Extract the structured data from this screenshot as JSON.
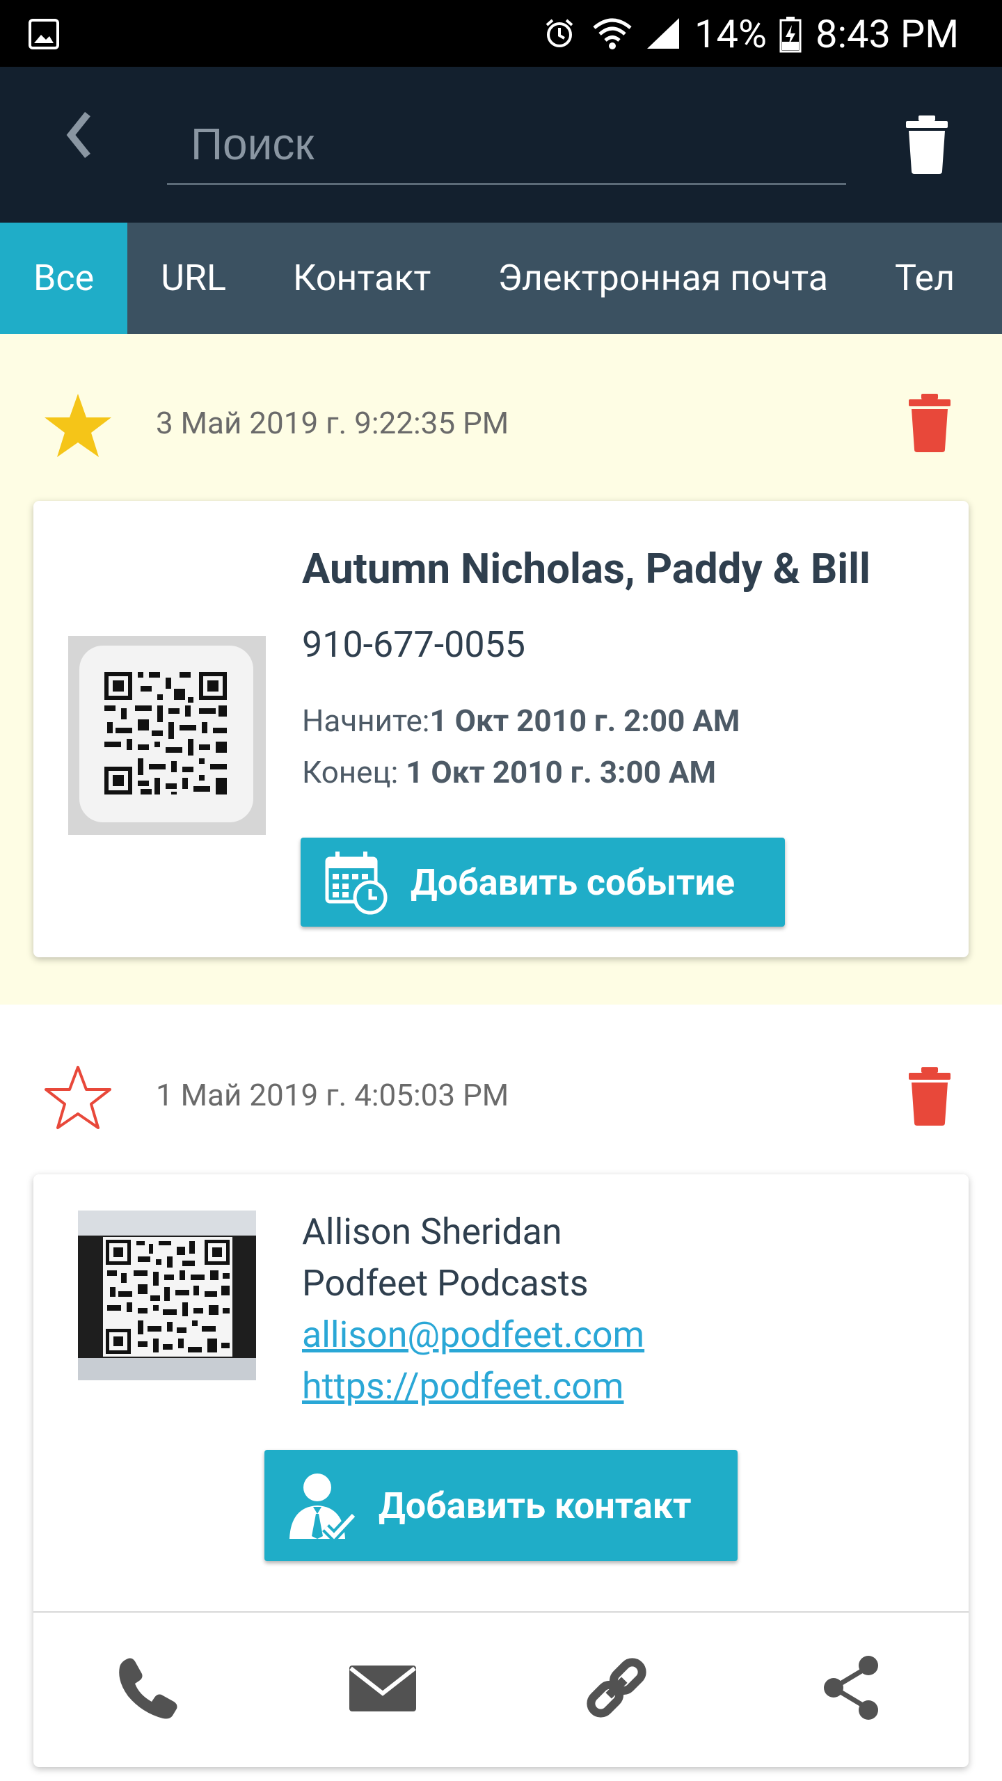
{
  "status_bar": {
    "battery": "14%",
    "time": "8:43 PM"
  },
  "toolbar": {
    "search_placeholder": "Поиск"
  },
  "tabs": [
    {
      "label": "Все",
      "active": true
    },
    {
      "label": "URL",
      "active": false
    },
    {
      "label": "Контакт",
      "active": false
    },
    {
      "label": "Электронная почта",
      "active": false
    },
    {
      "label": "Тел",
      "active": false
    }
  ],
  "items": [
    {
      "favorite": true,
      "date": "3 Май 2019 г. 9:22:35 PM",
      "title": "Autumn Nicholas, Paddy & Bill",
      "phone": "910-677-0055",
      "start_label": "Начните:",
      "start_value": "1 Окт 2010 г. 2:00 AM",
      "end_label": "Конец: ",
      "end_value": "1 Окт 2010 г. 3:00 AM",
      "button_label": "Добавить событие"
    },
    {
      "favorite": false,
      "date": "1 Май 2019 г. 4:05:03 PM",
      "name": "Allison Sheridan",
      "org": "Podfeet Podcasts",
      "email": "allison@podfeet.com",
      "url": "https://podfeet.com",
      "button_label": "Добавить контакт"
    }
  ],
  "colors": {
    "accent": "#1fadc8",
    "toolbar": "#13202e",
    "tabs": "#3b5161",
    "delete": "#e8483a",
    "star": "#f5c518",
    "highlight_bg": "#fefde4"
  }
}
